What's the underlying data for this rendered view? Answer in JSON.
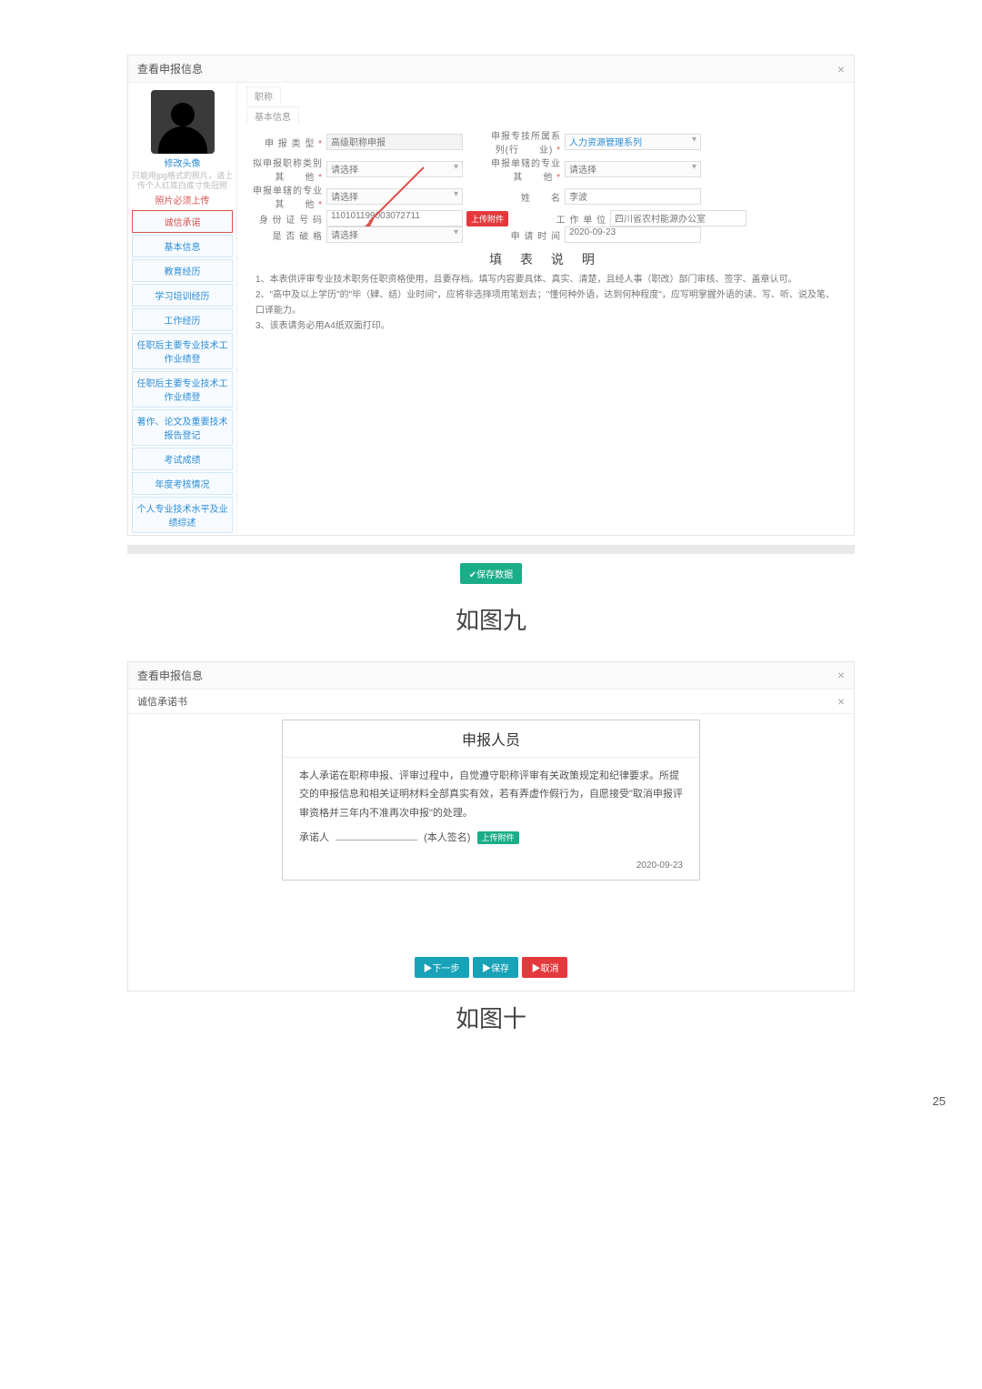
{
  "panel1": {
    "title": "查看申报信息",
    "tabs": [
      "职称",
      "基本信息"
    ],
    "side": {
      "avatar_caption": "修改头像",
      "avatar_note": "只能用jpg格式的照片，请上传个人红底白底寸免冠照",
      "upload_hint": "照片必须上传"
    },
    "menu": [
      "诚信承诺",
      "基本信息",
      "教育经历",
      "学习培训经历",
      "工作经历",
      "任职后主要专业技术工作业绩登",
      "任职后主要专业技术工作业绩登",
      "著作、论文及重要技术报告登记",
      "考试成绩",
      "年度考核情况",
      "个人专业技术水平及业绩综述"
    ],
    "fields": {
      "f1_lbl": "申 报 类 型",
      "f1_val": "高级职称申报",
      "f2_lbl": "申报专技所属系列(行　　业)",
      "f2_val": "人力资源管理系列",
      "f3_lbl": "拟申报职称类别其　　他",
      "f3_ph": "请选择",
      "f4_lbl": "申报单辖的专业其　　他",
      "f4_ph": "请选择",
      "f5_lbl": "申报单辖的专业其　　他",
      "f5_ph": "请选择",
      "f6_lbl": "姓　　名",
      "f6_val": "李波",
      "f7_lbl": "身 份 证 号 码",
      "f7_val": "110101199003072711",
      "f7_btn": "上传附件",
      "f8_lbl": "工 作 单 位",
      "f8_val": "四川省农村能源办公室",
      "f9_lbl": "是 否 破 格",
      "f9_ph": "请选择",
      "f10_lbl": "申 请 时 间",
      "f10_val": "2020-09-23"
    },
    "explain_title": "填 表 说 明",
    "explain": [
      "1、本表供评审专业技术职务任职资格使用，且要存档。填写内容要具体、真实、清楚，且经人事（职改）部门审核、签字、盖章认可。",
      "2、\"高中及以上学历\"的\"毕（肄、结）业时间\"，应将非选择项用笔划去；\"懂何种外语，达到何种程度\"，应写明掌握外语的读、写、听、说及笔、口译能力。",
      "3、该表请务必用A4纸双面打印。"
    ],
    "save_btn": "✔保存数据"
  },
  "caption1": "如图九",
  "panel2": {
    "title": "查看申报信息",
    "subtitle": "诚信承诺书",
    "letter_title": "申报人员",
    "letter_body": "本人承诺在职称申报、评审过程中，自觉遵守职称评审有关政策规定和纪律要求。所提交的申报信息和相关证明材料全部真实有效，若有弄虚作假行为，自愿接受\"取消申报评审资格并三年内不准再次申报\"的处理。",
    "sign_prefix": "承诺人",
    "sign_suffix": "(本人签名)",
    "sign_btn": "上传附件",
    "date": "2020-09-23",
    "btns": {
      "next": "▶下一步",
      "save": "▶保存",
      "close": "▶取消"
    }
  },
  "caption2": "如图十",
  "pagenum": "25"
}
